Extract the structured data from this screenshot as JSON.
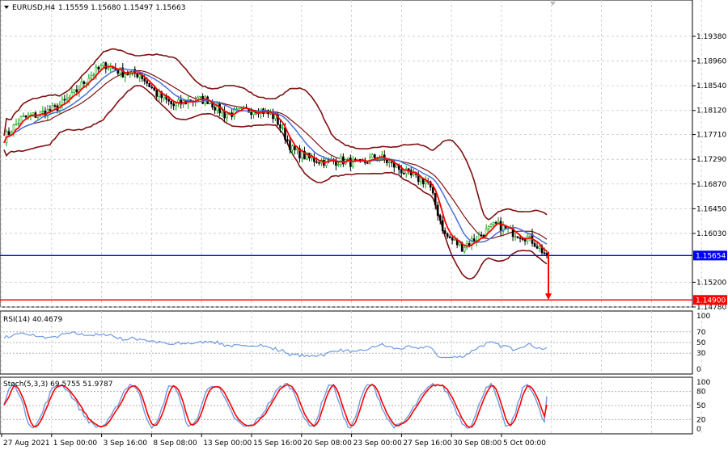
{
  "header": {
    "symbol_label": "EURUSD,H4",
    "ohlc": "1.15559 1.15680 1.15497 1.15663",
    "dropdown_icon": "triangle-down-icon"
  },
  "rsi_panel": {
    "label": "RSI(14) 40.4679",
    "levels": [
      "100",
      "70",
      "50",
      "30",
      "0"
    ]
  },
  "stoch_panel": {
    "label": "Stoch(5,3,3) 69.5755 51.9787",
    "levels": [
      "100",
      "80",
      "50",
      "20",
      "0"
    ]
  },
  "price_axis": {
    "labels": [
      "1.19380",
      "1.18960",
      "1.18540",
      "1.18120",
      "1.17710",
      "1.17290",
      "1.16870",
      "1.16450",
      "1.16030",
      "1.15200",
      "1.14780"
    ]
  },
  "time_axis": {
    "labels": [
      "27 Aug 2021",
      "1 Sep 00:00",
      "3 Sep 16:00",
      "8 Sep 08:00",
      "13 Sep 00:00",
      "15 Sep 16:00",
      "20 Sep 08:00",
      "23 Sep 00:00",
      "27 Sep 16:00",
      "30 Sep 08:00",
      "5 Oct 00:00"
    ]
  },
  "markers": {
    "bid_line": {
      "price": 1.15654,
      "label": "1.15654",
      "color": "#0000ff"
    },
    "target_line": {
      "price": 1.149,
      "label": "1.14900",
      "color": "#ff0000"
    }
  },
  "colors": {
    "bull_candle": "#00a000",
    "bear_candle": "#000000",
    "bollinger": "#7f1010",
    "fast_ma": "#ff0000",
    "slow_ma": "#4a6fd6",
    "rsi_line": "#6f9be0",
    "stoch_main": "#6f9be0",
    "stoch_signal": "#ff0000",
    "grid": "#c8c8c8"
  },
  "chart_data": {
    "type": "candlestick",
    "symbol": "EURUSD",
    "timeframe": "H4",
    "ylim": [
      1.1478,
      1.1975
    ],
    "x_start": "27 Aug 2021",
    "x_end": "6 Oct 2021",
    "close_anchors": [
      {
        "x": "27 Aug 2021",
        "y": 1.1765
      },
      {
        "x": "28 Aug 2021",
        "y": 1.1798
      },
      {
        "x": "30 Aug 2021",
        "y": 1.1805
      },
      {
        "x": "31 Aug 2021",
        "y": 1.1815
      },
      {
        "x": "1 Sep 2021",
        "y": 1.1836
      },
      {
        "x": "2 Sep 2021",
        "y": 1.187
      },
      {
        "x": "3 Sep 2021",
        "y": 1.189
      },
      {
        "x": "4 Sep 2021",
        "y": 1.1876
      },
      {
        "x": "6 Sep 2021",
        "y": 1.1874
      },
      {
        "x": "7 Sep 2021",
        "y": 1.184
      },
      {
        "x": "8 Sep 2021",
        "y": 1.182
      },
      {
        "x": "9 Sep 2021",
        "y": 1.183
      },
      {
        "x": "10 Sep 2021",
        "y": 1.183
      },
      {
        "x": "13 Sep 2021",
        "y": 1.1805
      },
      {
        "x": "14 Sep 2021",
        "y": 1.181
      },
      {
        "x": "15 Sep 2021",
        "y": 1.1815
      },
      {
        "x": "16 Sep 2021",
        "y": 1.18
      },
      {
        "x": "17 Sep 2021",
        "y": 1.1745
      },
      {
        "x": "18 Sep 2021",
        "y": 1.173
      },
      {
        "x": "20 Sep 2021",
        "y": 1.1725
      },
      {
        "x": "21 Sep 2021",
        "y": 1.1727
      },
      {
        "x": "22 Sep 2021",
        "y": 1.172
      },
      {
        "x": "23 Sep 2021",
        "y": 1.1735
      },
      {
        "x": "24 Sep 2021",
        "y": 1.1718
      },
      {
        "x": "27 Sep 2021",
        "y": 1.17
      },
      {
        "x": "28 Sep 2021",
        "y": 1.169
      },
      {
        "x": "29 Sep 2021",
        "y": 1.16
      },
      {
        "x": "30 Sep 2021",
        "y": 1.158
      },
      {
        "x": "1 Oct 2021",
        "y": 1.1598
      },
      {
        "x": "2 Oct 2021",
        "y": 1.1618
      },
      {
        "x": "4 Oct 2021",
        "y": 1.1605
      },
      {
        "x": "5 Oct 2021",
        "y": 1.1595
      },
      {
        "x": "6 Oct 2021",
        "y": 1.1566
      }
    ],
    "bollinger_upper_end": 1.1641,
    "bollinger_lower_end": 1.1548,
    "arrow_target": 1.149,
    "rsi": {
      "period": 14,
      "last": 40.4679,
      "ylim": [
        0,
        100
      ],
      "levels": [
        70,
        50,
        30
      ]
    },
    "stochastic": {
      "params": "5,3,3",
      "main_last": 69.5755,
      "signal_last": 51.9787,
      "ylim": [
        0,
        100
      ],
      "levels": [
        80,
        50,
        20
      ]
    }
  }
}
